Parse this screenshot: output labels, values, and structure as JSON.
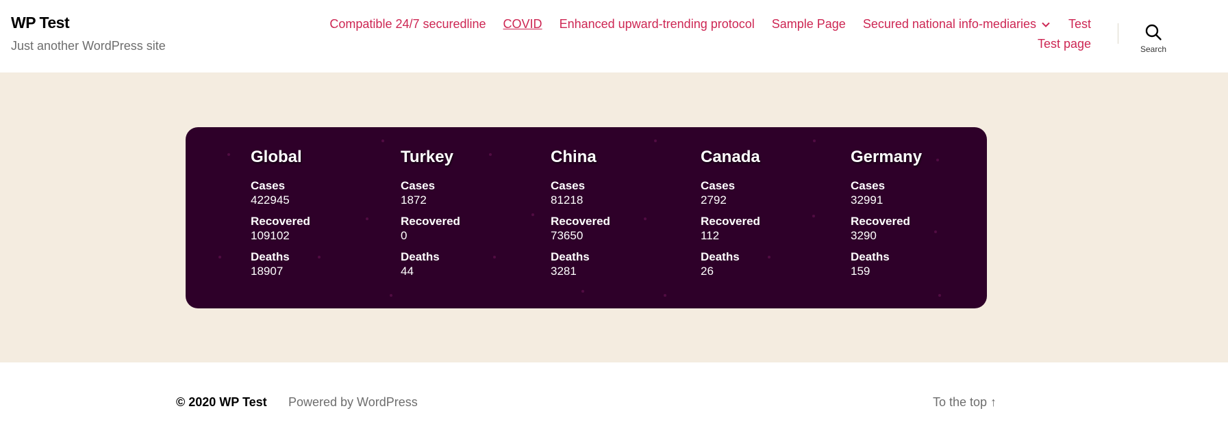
{
  "header": {
    "site_title": "WP Test",
    "site_description": "Just another WordPress site",
    "nav_row1": [
      {
        "label": "Compatible 24/7 securedline"
      },
      {
        "label": "COVID",
        "current": true
      },
      {
        "label": "Enhanced upward-trending protocol"
      },
      {
        "label": "Sample Page"
      },
      {
        "label": "Secured national info-mediaries",
        "has_submenu": true
      },
      {
        "label": "Test"
      }
    ],
    "nav_row2": [
      {
        "label": "Test page"
      }
    ],
    "search_label": "Search"
  },
  "covid": {
    "labels": {
      "cases": "Cases",
      "recovered": "Recovered",
      "deaths": "Deaths"
    },
    "regions": [
      {
        "name": "Global",
        "cases": "422945",
        "recovered": "109102",
        "deaths": "18907"
      },
      {
        "name": "Turkey",
        "cases": "1872",
        "recovered": "0",
        "deaths": "44"
      },
      {
        "name": "China",
        "cases": "81218",
        "recovered": "73650",
        "deaths": "3281"
      },
      {
        "name": "Canada",
        "cases": "2792",
        "recovered": "112",
        "deaths": "26"
      },
      {
        "name": "Germany",
        "cases": "32991",
        "recovered": "3290",
        "deaths": "159"
      }
    ]
  },
  "footer": {
    "copyright": "© 2020 WP Test",
    "powered_by": "Powered by WordPress",
    "to_top": "To the top ↑"
  },
  "colors": {
    "accent": "#cd2653",
    "card_background": "#2e0029",
    "band_background": "#f4ece0"
  }
}
